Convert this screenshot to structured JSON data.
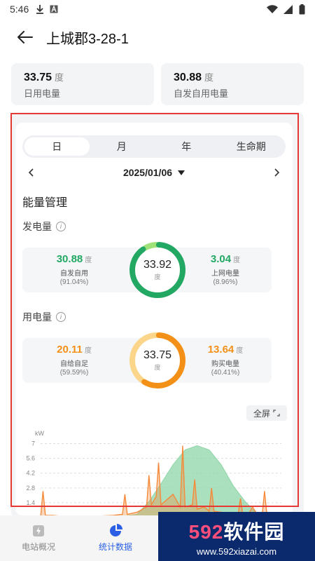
{
  "status": {
    "time": "5:46"
  },
  "header": {
    "title": "上城郡3-28-1"
  },
  "summary": [
    {
      "value": "33.75",
      "unit": "度",
      "label": "日用电量"
    },
    {
      "value": "30.88",
      "unit": "度",
      "label": "自发自用电量"
    }
  ],
  "tabs": [
    "日",
    "月",
    "年",
    "生命期"
  ],
  "date": "2025/01/06",
  "energy": {
    "title": "能量管理",
    "generation": {
      "title": "发电量",
      "left": {
        "value": "30.88",
        "unit": "度",
        "label": "自发自用",
        "pct": "(91.04%)"
      },
      "center": {
        "value": "33.92",
        "unit": "度"
      },
      "right": {
        "value": "3.04",
        "unit": "度",
        "label": "上网电量",
        "pct": "(8.96%)"
      },
      "ratio": 0.9104
    },
    "consumption": {
      "title": "用电量",
      "left": {
        "value": "20.11",
        "unit": "度",
        "label": "自给自足",
        "pct": "(59.59%)"
      },
      "center": {
        "value": "33.75",
        "unit": "度"
      },
      "right": {
        "value": "13.64",
        "unit": "度",
        "label": "购买电量",
        "pct": "(40.41%)"
      },
      "ratio": 0.5959
    }
  },
  "fullscreen_label": "全屏",
  "chart_data": {
    "type": "area",
    "ylabel": "kW",
    "y_ticks": [
      "7",
      "5.6",
      "4.2",
      "2.8",
      "1.4"
    ],
    "ylim": [
      0,
      7.5
    ],
    "series": [
      {
        "color": "#8fd6a8",
        "x": [
          0,
          15,
          30,
          40,
          45,
          50,
          55,
          60,
          65,
          70,
          75,
          80,
          85,
          90,
          100
        ],
        "values": [
          0,
          0,
          0,
          0.3,
          1.5,
          3.2,
          5.0,
          6.4,
          6.8,
          6.4,
          5.0,
          3.0,
          1.5,
          0.3,
          0
        ]
      },
      {
        "color": "#f58a3a",
        "x": [
          0,
          1,
          2,
          5,
          10,
          20,
          30,
          34,
          35,
          36,
          40,
          44,
          45,
          46,
          48,
          49,
          50,
          55,
          58,
          59,
          60,
          63,
          64,
          65,
          68,
          70,
          71,
          72,
          75,
          78,
          80,
          82,
          83,
          84,
          86,
          88,
          90,
          92,
          93,
          94,
          100
        ],
        "values": [
          0,
          2.5,
          0.2,
          0.2,
          0.1,
          0.1,
          0.2,
          0.3,
          2.2,
          0.3,
          0.5,
          1.0,
          4.0,
          1.2,
          2.0,
          5.2,
          1.2,
          2.2,
          1.0,
          6.8,
          1.0,
          1.2,
          3.6,
          0.8,
          1.0,
          0.6,
          2.8,
          0.6,
          0.5,
          0.4,
          0.3,
          0.3,
          1.8,
          0.2,
          0.2,
          1.0,
          0.3,
          0.2,
          2.5,
          0.2,
          0.1
        ]
      }
    ]
  },
  "bottom_nav": [
    {
      "label": "电站概况"
    },
    {
      "label": "统计数据"
    }
  ],
  "watermark": {
    "main_a": "592",
    "main_b": "软件园",
    "url": "www.592xiazai.com"
  },
  "colors": {
    "green": "#22a863",
    "light_green": "#9fe27a",
    "orange": "#f39018",
    "light_orange": "#fad58a",
    "accent_blue": "#2b5fe6",
    "highlight_red": "#e53935"
  }
}
